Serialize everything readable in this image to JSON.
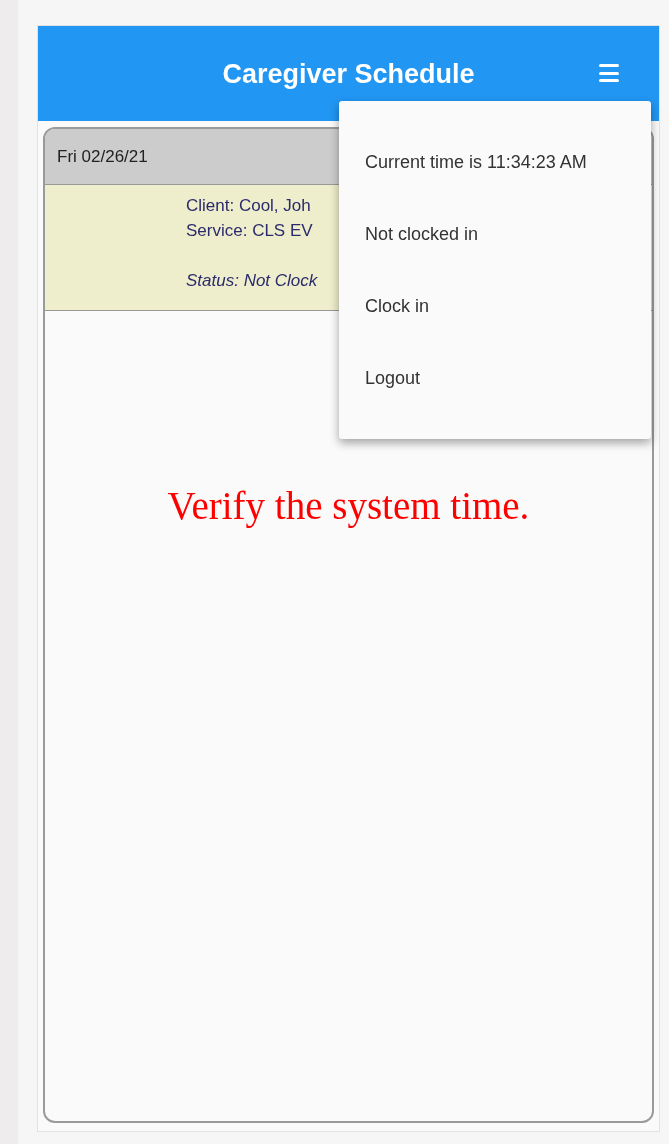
{
  "header": {
    "title": "Caregiver Schedule"
  },
  "schedule": {
    "date": "Fri 02/26/21",
    "visits": [
      {
        "lines": [
          "Client: Cool, Joh",
          "Service: CLS EV"
        ],
        "status": "Status: Not Clock"
      }
    ]
  },
  "message": "Verify the system time.",
  "menu": {
    "open": true,
    "items": [
      {
        "label": "Current time is 11:34:23 AM"
      },
      {
        "label": "Not clocked in"
      },
      {
        "label": "Clock in"
      },
      {
        "label": "Logout"
      }
    ]
  }
}
